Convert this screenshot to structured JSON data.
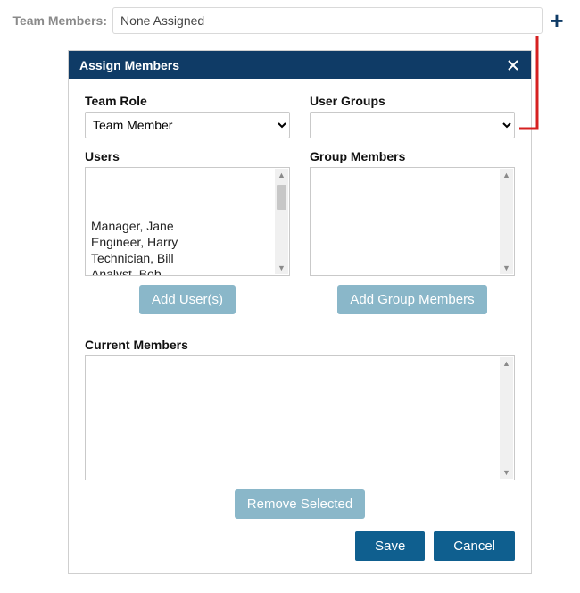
{
  "top": {
    "label": "Team Members:",
    "value": "None Assigned"
  },
  "modal": {
    "title": "Assign Members",
    "teamRole": {
      "label": "Team Role",
      "selected": "Team Member"
    },
    "userGroups": {
      "label": "User Groups",
      "selected": ""
    },
    "users": {
      "label": "Users",
      "items": [
        "Manager, Jane",
        "Engineer, Harry",
        "Technician, Bill",
        "Analyst, Bob"
      ],
      "addButton": "Add User(s)"
    },
    "groupMembers": {
      "label": "Group Members",
      "addButton": "Add Group Members"
    },
    "current": {
      "label": "Current Members",
      "removeButton": "Remove Selected"
    },
    "footer": {
      "save": "Save",
      "cancel": "Cancel"
    }
  }
}
